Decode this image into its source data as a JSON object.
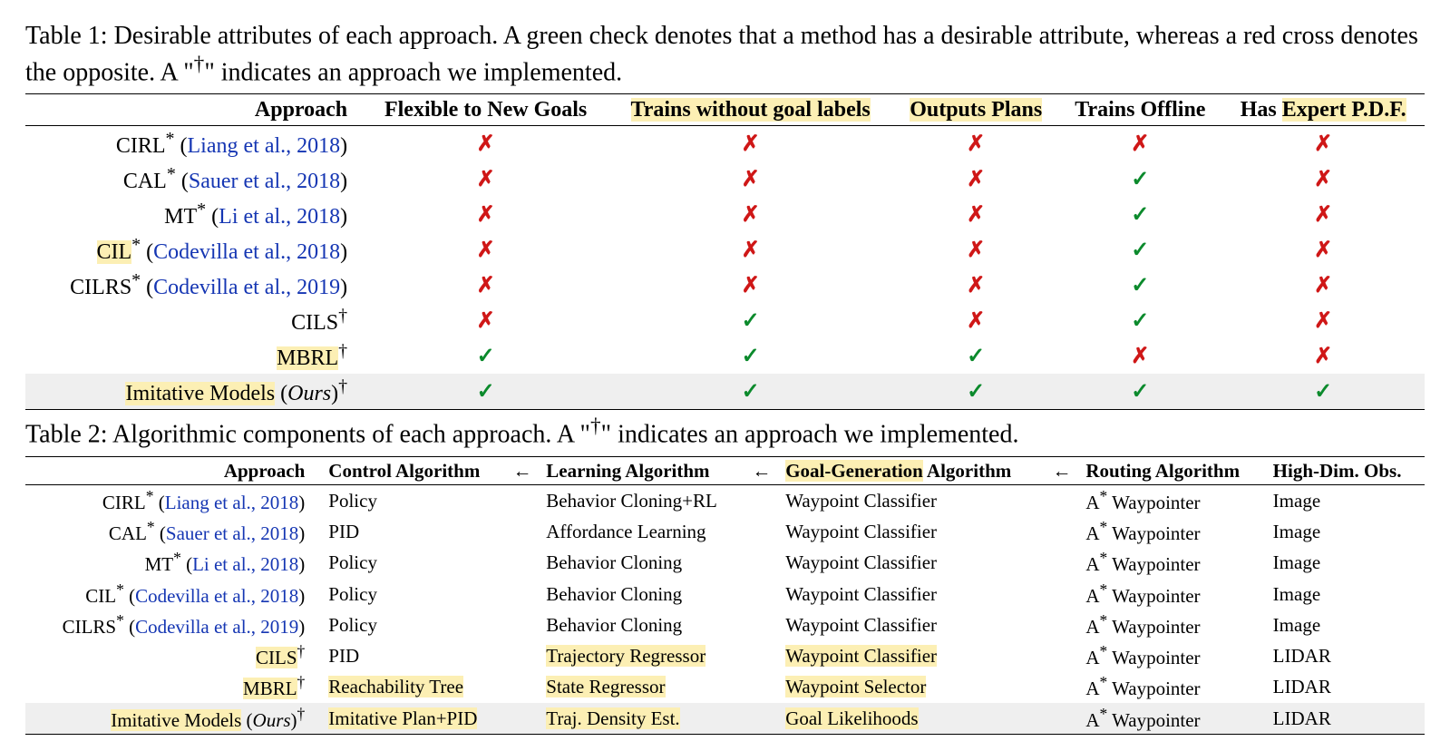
{
  "glyphs": {
    "check": "✓",
    "cross": "✗",
    "dagger": "†",
    "star": "*",
    "arrow": "←"
  },
  "t1": {
    "caption_prefix": "Table 1: Desirable attributes of each approach. A green check denotes that a method has a desirable attribute, whereas a red cross denotes the opposite. A \"",
    "caption_mid": "\" indicates an approach we implemented.",
    "headers": {
      "approach": "Approach",
      "c0": "Flexible to New Goals",
      "c1": "Trains without goal labels",
      "c2": "Outputs Plans",
      "c3": "Trains Offline",
      "c4_pre": "Has ",
      "c4_hl": "Expert P.D.F."
    },
    "rows": [
      {
        "name": "CIRL",
        "name_hl": false,
        "sup": "*",
        "cite": "Liang et al., 2018",
        "v": [
          "x",
          "x",
          "x",
          "x",
          "x"
        ],
        "gray": false
      },
      {
        "name": "CAL",
        "name_hl": false,
        "sup": "*",
        "cite": "Sauer et al., 2018",
        "v": [
          "x",
          "x",
          "x",
          "c",
          "x"
        ],
        "gray": false
      },
      {
        "name": "MT",
        "name_hl": false,
        "sup": "*",
        "cite": "Li et al., 2018",
        "v": [
          "x",
          "x",
          "x",
          "c",
          "x"
        ],
        "gray": false
      },
      {
        "name": "CIL",
        "name_hl": true,
        "sup": "*",
        "cite": "Codevilla et al., 2018",
        "v": [
          "x",
          "x",
          "x",
          "c",
          "x"
        ],
        "gray": false
      },
      {
        "name": "CILRS",
        "name_hl": false,
        "sup": "*",
        "cite": "Codevilla et al., 2019",
        "v": [
          "x",
          "x",
          "x",
          "c",
          "x"
        ],
        "gray": false
      },
      {
        "name": "CILS",
        "name_hl": false,
        "sup": "†",
        "cite": "",
        "v": [
          "x",
          "c",
          "x",
          "c",
          "x"
        ],
        "gray": false
      },
      {
        "name": "MBRL",
        "name_hl": true,
        "sup": "†",
        "cite": "",
        "v": [
          "c",
          "c",
          "c",
          "x",
          "x"
        ],
        "gray": false
      },
      {
        "name": "Imitative Models",
        "name_hl": true,
        "sup": "†",
        "cite": "",
        "ours": true,
        "v": [
          "c",
          "c",
          "c",
          "c",
          "c"
        ],
        "gray": true
      }
    ]
  },
  "t2": {
    "caption_prefix": "Table 2: Algorithmic components of each approach. A \"",
    "caption_mid": "\" indicates an approach we implemented.",
    "headers": {
      "approach": "Approach",
      "c0": "Control Algorithm",
      "c1": "Learning Algorithm",
      "c2_hl": "Goal-Generation",
      "c2_suffix": " Algorithm",
      "c3": "Routing Algorithm",
      "c4": "High-Dim. Obs."
    },
    "rows": [
      {
        "name": "CIRL",
        "name_hl": false,
        "sup": "*",
        "cite": "Liang et al., 2018",
        "c": [
          "Policy",
          "Behavior Cloning+RL",
          "Waypoint Classifier",
          "A* Waypointer",
          "Image"
        ],
        "hl": [
          0,
          0,
          0,
          0,
          0
        ],
        "gray": false
      },
      {
        "name": "CAL",
        "name_hl": false,
        "sup": "*",
        "cite": "Sauer et al., 2018",
        "c": [
          "PID",
          "Affordance Learning",
          "Waypoint Classifier",
          "A* Waypointer",
          "Image"
        ],
        "hl": [
          0,
          0,
          0,
          0,
          0
        ],
        "gray": false
      },
      {
        "name": "MT",
        "name_hl": false,
        "sup": "*",
        "cite": "Li et al., 2018",
        "c": [
          "Policy",
          "Behavior Cloning",
          "Waypoint Classifier",
          "A* Waypointer",
          "Image"
        ],
        "hl": [
          0,
          0,
          0,
          0,
          0
        ],
        "gray": false
      },
      {
        "name": "CIL",
        "name_hl": false,
        "sup": "*",
        "cite": "Codevilla et al., 2018",
        "c": [
          "Policy",
          "Behavior Cloning",
          "Waypoint Classifier",
          "A* Waypointer",
          "Image"
        ],
        "hl": [
          0,
          0,
          0,
          0,
          0
        ],
        "gray": false
      },
      {
        "name": "CILRS",
        "name_hl": false,
        "sup": "*",
        "cite": "Codevilla et al., 2019",
        "c": [
          "Policy",
          "Behavior Cloning",
          "Waypoint Classifier",
          "A* Waypointer",
          "Image"
        ],
        "hl": [
          0,
          0,
          0,
          0,
          0
        ],
        "gray": false
      },
      {
        "name": "CILS",
        "name_hl": true,
        "sup": "†",
        "cite": "",
        "c": [
          "PID",
          "Trajectory Regressor",
          "Waypoint Classifier",
          "A* Waypointer",
          "LIDAR"
        ],
        "hl": [
          0,
          1,
          1,
          0,
          0
        ],
        "gray": false
      },
      {
        "name": "MBRL",
        "name_hl": true,
        "sup": "†",
        "cite": "",
        "c": [
          "Reachability Tree",
          "State Regressor",
          "Waypoint Selector",
          "A* Waypointer",
          "LIDAR"
        ],
        "hl": [
          1,
          1,
          1,
          0,
          0
        ],
        "gray": false
      },
      {
        "name": "Imitative Models",
        "name_hl": true,
        "sup": "†",
        "cite": "",
        "ours": true,
        "c": [
          "Imitative Plan+PID",
          "Traj. Density Est.",
          "Goal Likelihoods",
          "A* Waypointer",
          "LIDAR"
        ],
        "hl": [
          1,
          1,
          1,
          0,
          0
        ],
        "gray": true
      }
    ]
  }
}
